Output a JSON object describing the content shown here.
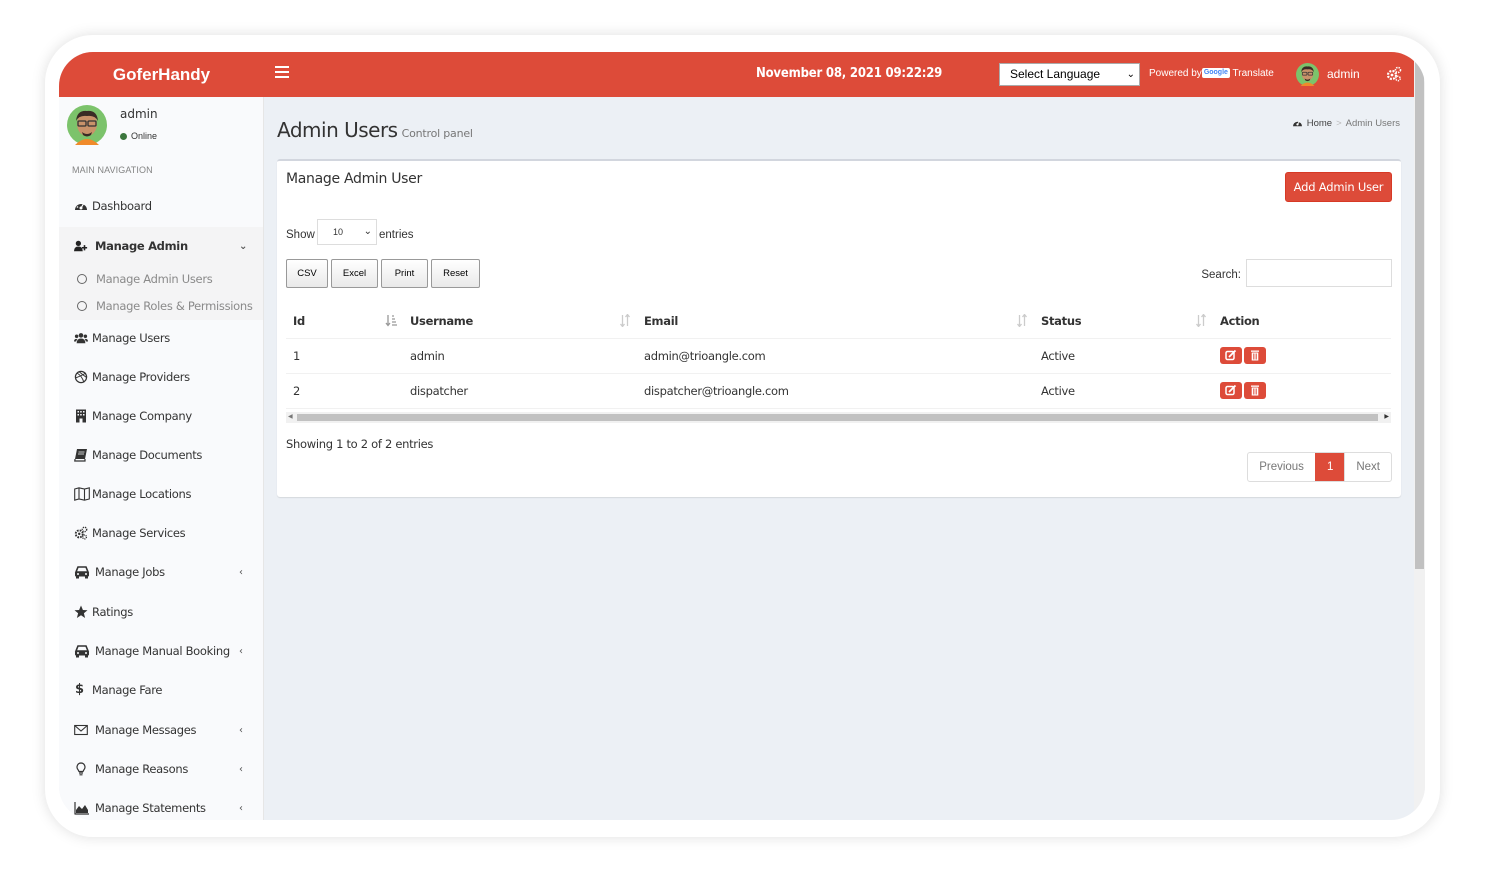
{
  "header": {
    "brand": "GoferHandy",
    "datetime": "November 08, 2021 09:22:29",
    "language_select": "Select Language",
    "powered_by": "Powered by",
    "google_label": "Google",
    "translate_label": "Translate",
    "username": "admin",
    "icons": {
      "menu": "hamburger-icon",
      "settings": "gears-icon"
    }
  },
  "sidebar": {
    "user": {
      "name": "admin",
      "status": "Online"
    },
    "nav_header": "MAIN NAVIGATION",
    "items": [
      {
        "label": "Dashboard",
        "icon": "dashboard-icon"
      },
      {
        "label": "Manage Admin",
        "icon": "user-plus-icon",
        "expanded": true,
        "children": [
          {
            "label": "Manage Admin Users"
          },
          {
            "label": "Manage Roles & Permissions"
          }
        ]
      },
      {
        "label": "Manage Users",
        "icon": "users-icon"
      },
      {
        "label": "Manage Providers",
        "icon": "dribbble-icon"
      },
      {
        "label": "Manage Company",
        "icon": "building-icon"
      },
      {
        "label": "Manage Documents",
        "icon": "book-icon"
      },
      {
        "label": "Manage Locations",
        "icon": "map-icon"
      },
      {
        "label": "Manage Services",
        "icon": "gears-icon"
      },
      {
        "label": "Manage Jobs",
        "icon": "taxi-icon",
        "has_submenu": true
      },
      {
        "label": "Ratings",
        "icon": "star-icon"
      },
      {
        "label": "Manage Manual Booking",
        "icon": "taxi-icon",
        "has_submenu": true
      },
      {
        "label": "Manage Fare",
        "icon": "dollar-icon"
      },
      {
        "label": "Manage Messages",
        "icon": "envelope-icon",
        "has_submenu": true
      },
      {
        "label": "Manage Reasons",
        "icon": "lightbulb-icon",
        "has_submenu": true
      },
      {
        "label": "Manage Statements",
        "icon": "area-chart-icon",
        "has_submenu": true
      }
    ]
  },
  "page": {
    "title": "Admin Users",
    "subtitle": "Control panel",
    "breadcrumb": [
      "Home",
      "Admin Users"
    ]
  },
  "box": {
    "title": "Manage Admin User",
    "add_button": "Add Admin User",
    "show_label": "Show",
    "entries_label": "entries",
    "page_length": "10",
    "export_buttons": [
      "CSV",
      "Excel",
      "Print",
      "Reset"
    ],
    "search_label": "Search:",
    "search_value": "",
    "table": {
      "columns": [
        "Id",
        "Username",
        "Email",
        "Status",
        "Action"
      ],
      "rows": [
        {
          "id": "1",
          "username": "admin",
          "email": "admin@trioangle.com",
          "status": "Active"
        },
        {
          "id": "2",
          "username": "dispatcher",
          "email": "dispatcher@trioangle.com",
          "status": "Active"
        }
      ]
    },
    "info": "Showing 1 to 2 of 2 entries",
    "pagination": {
      "previous": "Previous",
      "current": "1",
      "next": "Next"
    }
  },
  "colors": {
    "accent": "#dd4b39",
    "sidebar_bg": "#f9fafc",
    "content_bg": "#ecf0f5",
    "online": "#3c763d"
  }
}
